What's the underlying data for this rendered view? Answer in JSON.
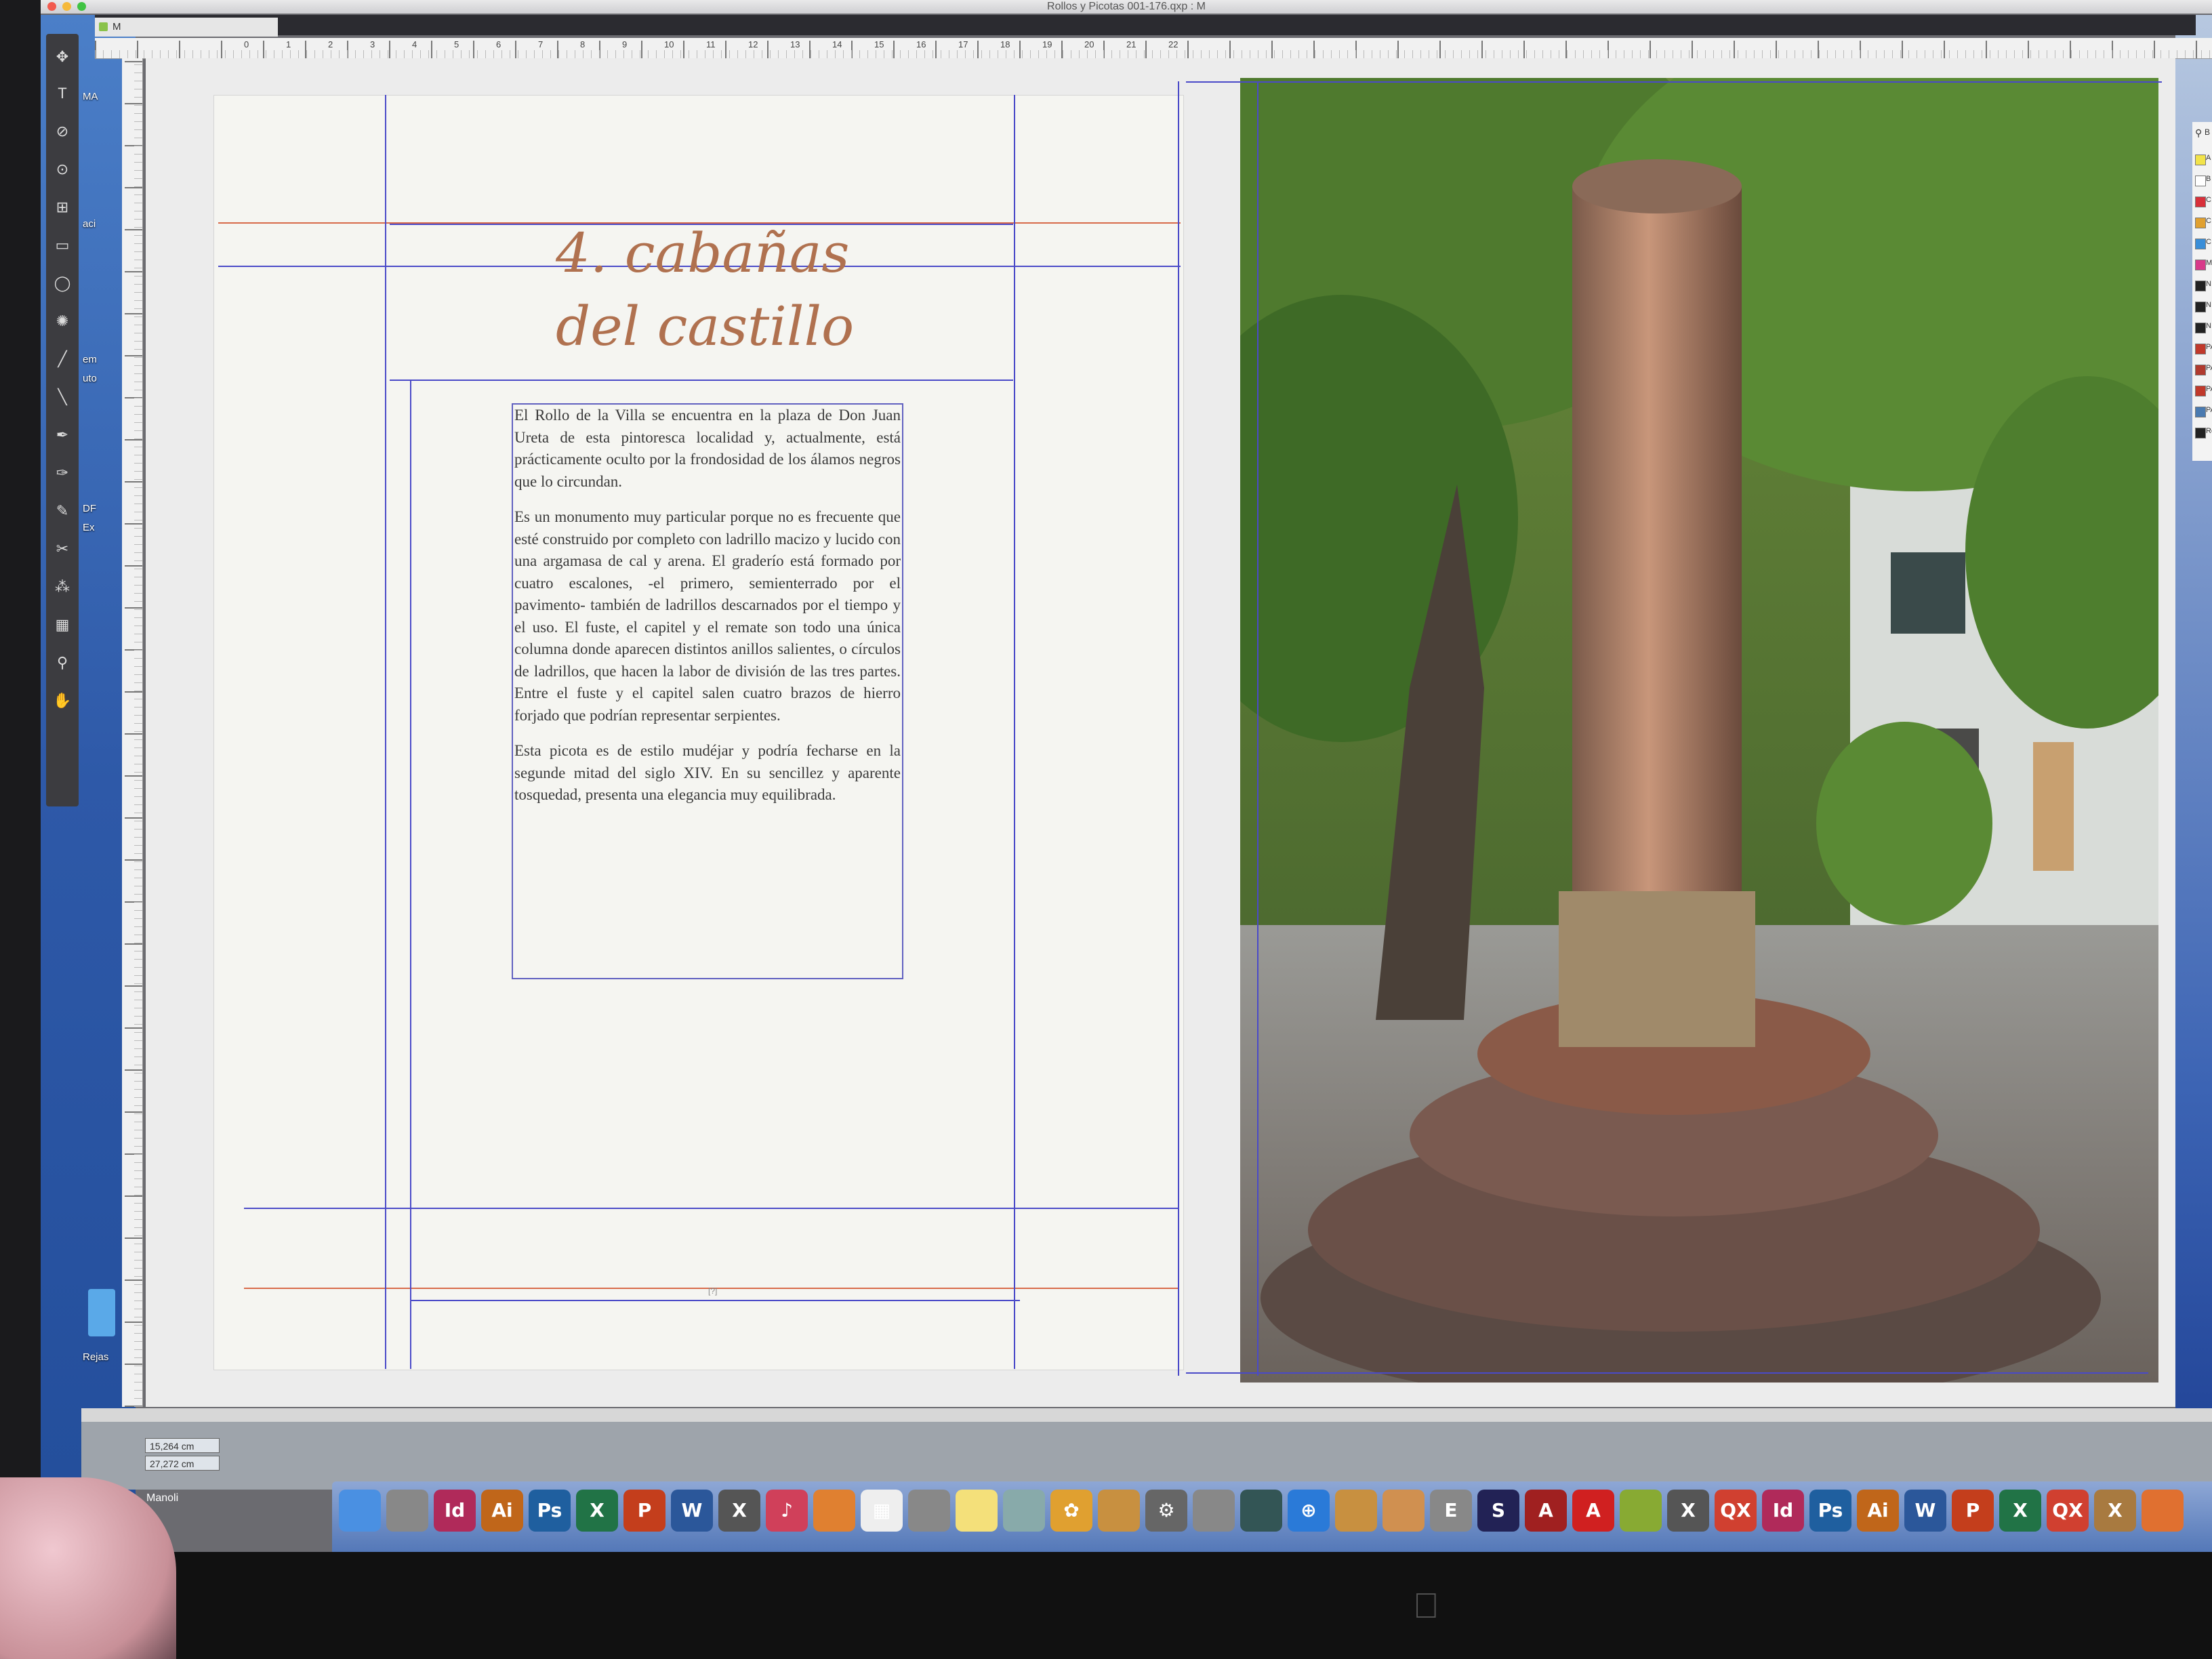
{
  "window": {
    "title": "Rollos y Picotas 001-176.qxp : M",
    "tab": "M"
  },
  "ruler": {
    "ticks": [
      "0",
      "1",
      "2",
      "3",
      "4",
      "5",
      "6",
      "7",
      "8",
      "9",
      "10",
      "11",
      "12",
      "13",
      "14",
      "15",
      "16",
      "17",
      "18",
      "19",
      "20",
      "21",
      "22"
    ]
  },
  "desktop": {
    "left_labels": [
      "MA",
      "aci",
      "em",
      "uto",
      "DF",
      "Ex",
      "Rejas"
    ]
  },
  "document": {
    "heading_line1": "4. cabañas",
    "heading_line2": "del castillo",
    "body": [
      "El Rollo de la Villa se encuentra en la plaza de Don Juan Ureta de esta pintoresca localidad y, actualmente, está prácticamente oculto por la frondosidad de los álamos negros que lo circundan.",
      "Es un monumento muy particular porque no es frecuente que esté construido por completo con ladrillo macizo y lucido con una argamasa de cal y arena. El graderío está formado por cuatro escalones, -el primero, semienterrado por el pavimento- también de ladrillos descarnados por el tiempo y el uso. El fuste, el capitel y el remate son todo una única columna donde aparecen distintos anillos salientes, o círculos de ladrillos, que hacen la labor de división de las tres partes. Entre el fuste y el capitel salen cuatro brazos de hierro forjado que podrían representar serpientes.",
      "Esta picota es de estilo mudéjar y podría fecharse en la segunde mitad del siglo XIV. En su sencillez y aparente tosquedad, presenta una elegancia muy equilibrada."
    ],
    "folio": "[?]"
  },
  "swatches": [
    {
      "label": "A",
      "color": "#f2e34a"
    },
    {
      "label": "B",
      "color": "#ffffff"
    },
    {
      "label": "C",
      "color": "#d8303a"
    },
    {
      "label": "C",
      "color": "#e0a030"
    },
    {
      "label": "C",
      "color": "#3a8ed8"
    },
    {
      "label": "M",
      "color": "#d83a8a"
    },
    {
      "label": "N",
      "color": "#222222"
    },
    {
      "label": "N",
      "color": "#222222"
    },
    {
      "label": "N",
      "color": "#222222"
    },
    {
      "label": "PA",
      "color": "#c0392b"
    },
    {
      "label": "PA",
      "color": "#b03a2e"
    },
    {
      "label": "PA",
      "color": "#c0392b"
    },
    {
      "label": "PA",
      "color": "#4a7ab0"
    },
    {
      "label": "Re",
      "color": "#222222"
    }
  ],
  "swatch_search": "B",
  "coords": {
    "x": "15,264 cm",
    "y": "27,272 cm"
  },
  "user": "Manoli",
  "dock": [
    {
      "label": "",
      "color": "#4a90e2"
    },
    {
      "label": "",
      "color": "#888"
    },
    {
      "label": "Id",
      "color": "#b02a5a"
    },
    {
      "label": "Ai",
      "color": "#c0661a"
    },
    {
      "label": "Ps",
      "color": "#1f5f9f"
    },
    {
      "label": "X",
      "color": "#217346"
    },
    {
      "label": "P",
      "color": "#c43e1c"
    },
    {
      "label": "W",
      "color": "#2b579a"
    },
    {
      "label": "X",
      "color": "#555"
    },
    {
      "label": "♪",
      "color": "#d0405a"
    },
    {
      "label": "",
      "color": "#e08030"
    },
    {
      "label": "▦",
      "color": "#eee"
    },
    {
      "label": "",
      "color": "#888"
    },
    {
      "label": "",
      "color": "#f4e07a"
    },
    {
      "label": "",
      "color": "#8aa"
    },
    {
      "label": "✿",
      "color": "#e0a030"
    },
    {
      "label": "",
      "color": "#c89040"
    },
    {
      "label": "⚙",
      "color": "#666"
    },
    {
      "label": "",
      "color": "#888"
    },
    {
      "label": "",
      "color": "#355"
    },
    {
      "label": "⊕",
      "color": "#2a7ad8"
    },
    {
      "label": "",
      "color": "#c89040"
    },
    {
      "label": "",
      "color": "#d09050"
    },
    {
      "label": "E",
      "color": "#888"
    },
    {
      "label": "S",
      "color": "#225"
    },
    {
      "label": "A",
      "color": "#a02020"
    },
    {
      "label": "A",
      "color": "#d02020"
    },
    {
      "label": "",
      "color": "#8a3"
    },
    {
      "label": "X",
      "color": "#555"
    },
    {
      "label": "QX",
      "color": "#d04030"
    },
    {
      "label": "Id",
      "color": "#b02a5a"
    },
    {
      "label": "Ps",
      "color": "#1f5f9f"
    },
    {
      "label": "Ai",
      "color": "#c0661a"
    },
    {
      "label": "W",
      "color": "#2b579a"
    },
    {
      "label": "P",
      "color": "#c43e1c"
    },
    {
      "label": "X",
      "color": "#217346"
    },
    {
      "label": "QX",
      "color": "#d04030"
    },
    {
      "label": "X",
      "color": "#a87a40"
    },
    {
      "label": "",
      "color": "#e07030"
    }
  ]
}
